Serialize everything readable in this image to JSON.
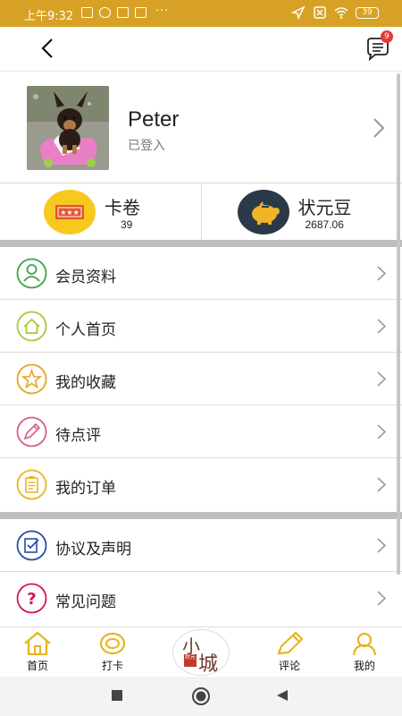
{
  "status_bar": {
    "time": "上午9:32",
    "more": "···",
    "battery": "39"
  },
  "header": {
    "message_badge": "9"
  },
  "profile": {
    "name": "Peter",
    "status": "已登入"
  },
  "stats": [
    {
      "label": "卡卷",
      "value": "39",
      "icon_color": "#f7c91f",
      "icon": "ticket-icon"
    },
    {
      "label": "状元豆",
      "value": "2687.06",
      "icon_color": "#2b3a4a",
      "icon": "piggy-bank-icon"
    }
  ],
  "menu_group_1": [
    {
      "label": "会员资料",
      "icon": "member-info-icon",
      "color": "#3aa541"
    },
    {
      "label": "个人首页",
      "icon": "home-icon",
      "color": "#a8c83c"
    },
    {
      "label": "我的收藏",
      "icon": "star-icon",
      "color": "#e8a31e"
    },
    {
      "label": "待点评",
      "icon": "pencil-icon",
      "color": "#d95b8a"
    },
    {
      "label": "我的订单",
      "icon": "clipboard-icon",
      "color": "#e8b420"
    }
  ],
  "menu_group_2": [
    {
      "label": "协议及声明",
      "icon": "agreement-icon",
      "color": "#2a4aa8"
    },
    {
      "label": "常见问题",
      "icon": "question-icon",
      "color": "#d4145a"
    }
  ],
  "tabs": [
    {
      "label": "首页",
      "icon": "home-tab-icon"
    },
    {
      "label": "打卡",
      "icon": "checkin-tab-icon"
    },
    {
      "label": "评论",
      "icon": "comment-tab-icon"
    },
    {
      "label": "我的",
      "icon": "profile-tab-icon"
    }
  ],
  "center_logo": {
    "text_top": "小",
    "text_bottom": "城",
    "seal": "状元"
  },
  "colors": {
    "accent": "#d7a125",
    "tab_icon": "#e8b420",
    "separator": "#bfbfbf"
  }
}
